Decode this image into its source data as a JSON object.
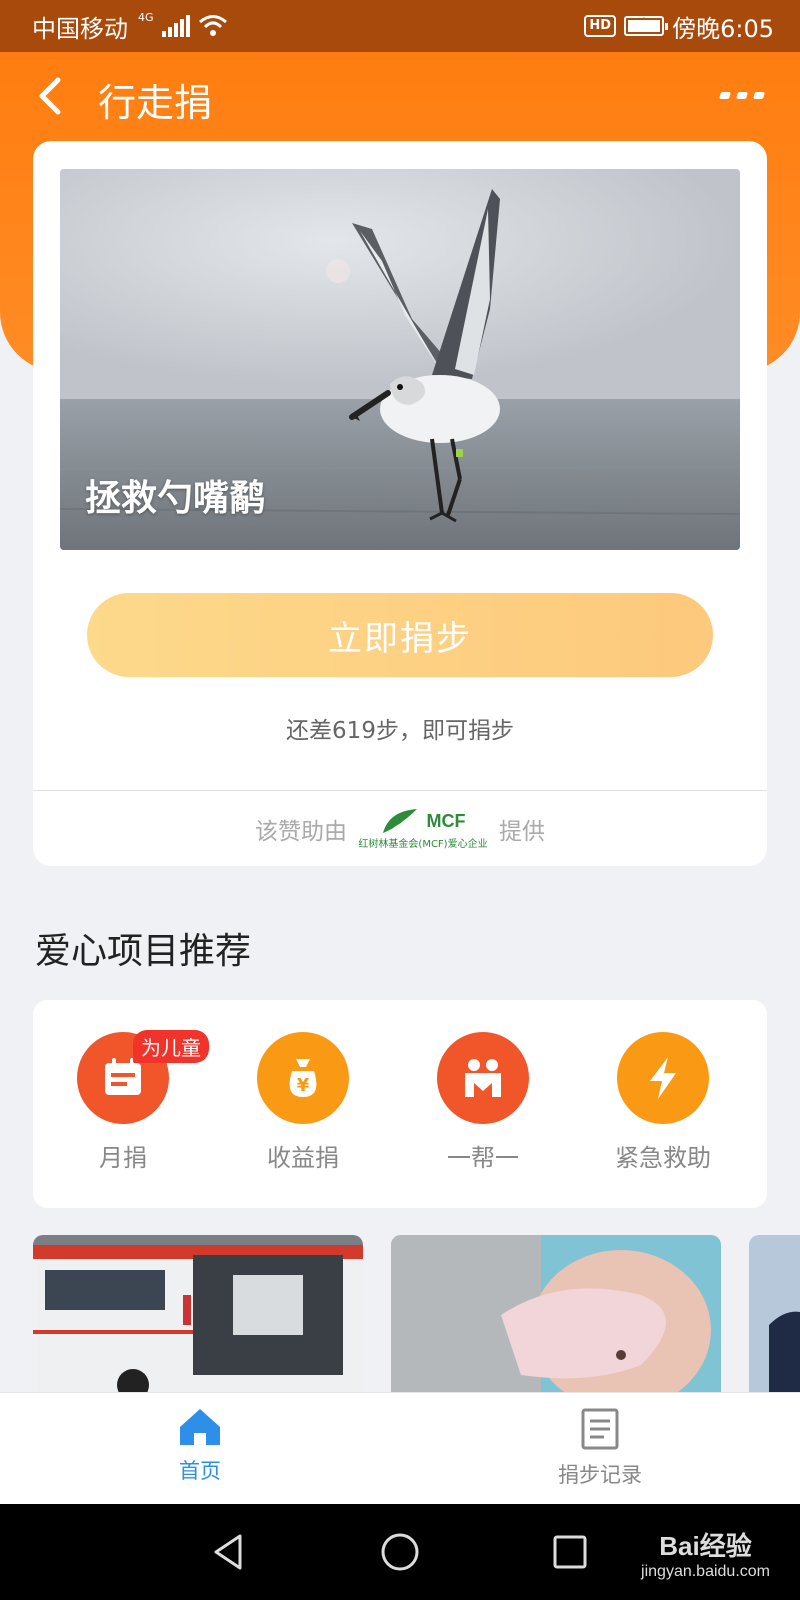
{
  "status_bar": {
    "carrier": "中国移动",
    "network": "4G",
    "hd_label": "HD",
    "time": "傍晚6:05"
  },
  "nav": {
    "title": "行走捐",
    "back_icon": "chevron-left-icon",
    "more_icon": "more-dots-icon"
  },
  "project": {
    "title": "拯救勺嘴鹬",
    "donate_button": "立即捐步",
    "steps_hint": "还差619步，即可捐步",
    "sponsor_prefix": "该赞助由",
    "sponsor_suffix": "提供",
    "sponsor_logo_text": "MCF",
    "sponsor_logo_sub": "红树林基金会(MCF)爱心企业"
  },
  "recommend": {
    "section_title": "爱心项目推荐",
    "categories": [
      {
        "label": "月捐",
        "badge": "为儿童",
        "icon": "calendar-icon",
        "color": "#f0562a"
      },
      {
        "label": "收益捐",
        "badge": "",
        "icon": "money-bag-icon",
        "color": "#fa9a14"
      },
      {
        "label": "一帮一",
        "badge": "",
        "icon": "helping-people-icon",
        "color": "#f0562a"
      },
      {
        "label": "紧急救助",
        "badge": "",
        "icon": "lightning-icon",
        "color": "#fa9a14"
      }
    ]
  },
  "tabbar": {
    "home_label": "首页",
    "records_label": "捐步记录",
    "active_color": "#2d8fe8"
  },
  "watermark": {
    "line1": "Bai经验",
    "line2": "jingyan.baidu.com"
  }
}
